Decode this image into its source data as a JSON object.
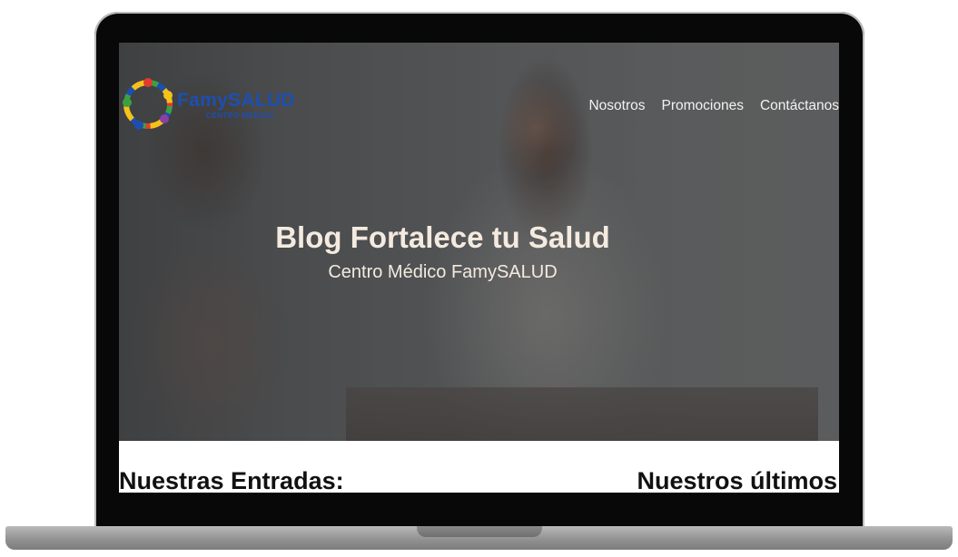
{
  "brand": {
    "name_part1": "Famy",
    "name_part2": "SALUD",
    "tagline": "CENTRO MÉDICO",
    "colors": {
      "blue": "#1d4fb0",
      "green": "#3aa142",
      "red": "#e23b2e",
      "yellow": "#f5c21b",
      "purple": "#8a3ea6"
    }
  },
  "nav": {
    "items": [
      "Nosotros",
      "Promociones",
      "Contáctanos"
    ]
  },
  "hero": {
    "title": "Blog Fortalece tu Salud",
    "subtitle": "Centro Médico FamySALUD"
  },
  "content": {
    "left_heading": "Nuestras Entradas:",
    "right_heading": "Nuestros últimos"
  }
}
